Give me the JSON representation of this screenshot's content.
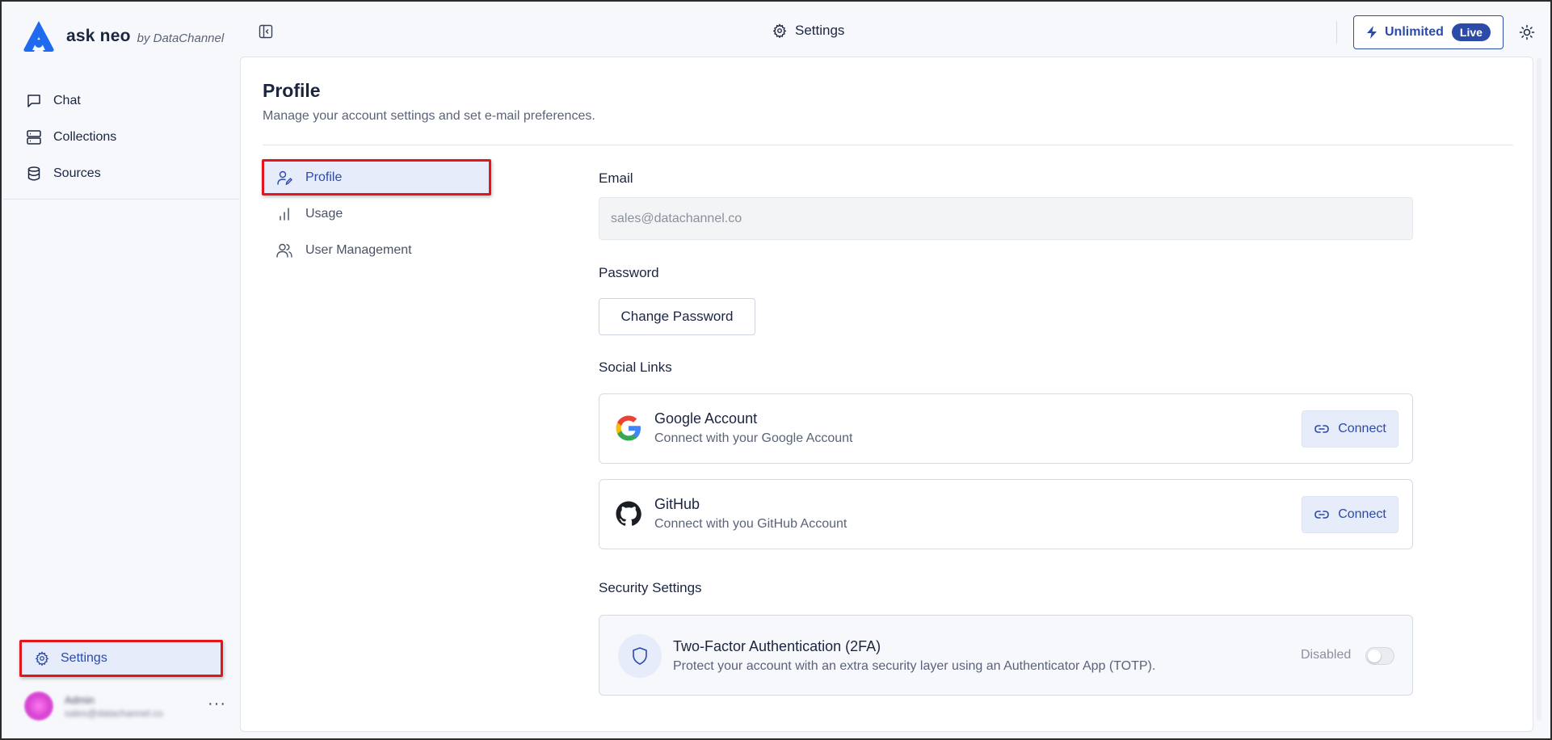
{
  "brand": {
    "name": "ask neo",
    "by": "by DataChannel",
    "logo_color": "#1f6af0"
  },
  "sidebar": {
    "items": [
      {
        "label": "Chat",
        "icon": "message-square-icon"
      },
      {
        "label": "Collections",
        "icon": "server-icon"
      },
      {
        "label": "Sources",
        "icon": "database-icon"
      }
    ],
    "settings_label": "Settings",
    "user": {
      "name": "Admin",
      "email": "sales@datachannel.co"
    },
    "more_label": "···"
  },
  "topbar": {
    "title": "Settings",
    "plan_label": "Unlimited",
    "plan_badge": "Live"
  },
  "page": {
    "title": "Profile",
    "subtitle": "Manage your account settings and set e-mail preferences."
  },
  "subnav": {
    "items": [
      {
        "label": "Profile",
        "icon": "user-pen-icon",
        "active": true
      },
      {
        "label": "Usage",
        "icon": "bar-chart-icon",
        "active": false
      },
      {
        "label": "User Management",
        "icon": "users-icon",
        "active": false
      }
    ]
  },
  "form": {
    "email_label": "Email",
    "email_value": "sales@datachannel.co",
    "password_label": "Password",
    "change_password_label": "Change Password",
    "social_label": "Social Links",
    "social": [
      {
        "name": "Google Account",
        "desc": "Connect with your Google Account",
        "button": "Connect",
        "icon": "google-icon"
      },
      {
        "name": "GitHub",
        "desc": "Connect with you GitHub Account",
        "button": "Connect",
        "icon": "github-icon"
      }
    ],
    "security_label": "Security Settings",
    "tfa": {
      "title": "Two-Factor Authentication (2FA)",
      "desc": "Protect your account with an extra security layer using an Authenticator App (TOTP).",
      "status": "Disabled",
      "enabled": false
    }
  },
  "colors": {
    "accent": "#2c4aa8",
    "active_bg": "#e6ecfa",
    "highlight_border": "#e3141b"
  }
}
